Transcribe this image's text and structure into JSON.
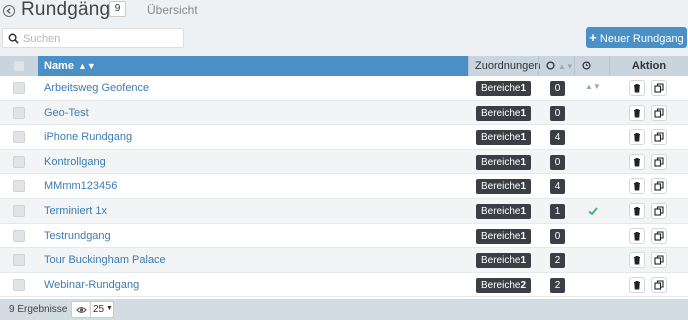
{
  "header": {
    "title": "Rundgänge",
    "count": "9",
    "subtitle": "Übersicht"
  },
  "toolbar": {
    "search_placeholder": "Suchen",
    "new_button_label": "Neuer Rundgang"
  },
  "table": {
    "columns": {
      "name": "Name",
      "zuordnungen": "Zuordnungen",
      "aktion": "Aktion"
    },
    "rows": [
      {
        "name": "Arbeitsweg Geofence",
        "bereiche_label": "Bereiche",
        "bereiche_count": "1",
        "count": "0",
        "checked": false
      },
      {
        "name": "Geo-Test",
        "bereiche_label": "Bereiche",
        "bereiche_count": "1",
        "count": "0",
        "checked": false
      },
      {
        "name": "iPhone Rundgang",
        "bereiche_label": "Bereiche",
        "bereiche_count": "1",
        "count": "4",
        "checked": false
      },
      {
        "name": "Kontrollgang",
        "bereiche_label": "Bereiche",
        "bereiche_count": "1",
        "count": "0",
        "checked": false
      },
      {
        "name": "MMmm123456",
        "bereiche_label": "Bereiche",
        "bereiche_count": "1",
        "count": "4",
        "checked": false
      },
      {
        "name": "Terminiert 1x",
        "bereiche_label": "Bereiche",
        "bereiche_count": "1",
        "count": "1",
        "checked": true
      },
      {
        "name": "Testrundgang",
        "bereiche_label": "Bereiche",
        "bereiche_count": "1",
        "count": "0",
        "checked": false
      },
      {
        "name": "Tour Buckingham Palace",
        "bereiche_label": "Bereiche",
        "bereiche_count": "1",
        "count": "2",
        "checked": false
      },
      {
        "name": "Webinar-Rundgang",
        "bereiche_label": "Bereiche",
        "bereiche_count": "2",
        "count": "2",
        "checked": false
      }
    ]
  },
  "footer": {
    "results": "9 Ergebnisse",
    "page_size": "25"
  },
  "colors": {
    "accent": "#4a90c7",
    "link": "#3d7cb5",
    "pill_dark": "#3b3f45",
    "success": "#3cb371"
  },
  "icons": [
    "back-circle-icon",
    "search-icon",
    "plus-icon",
    "sort-icon",
    "clock-icon",
    "trash-icon",
    "copy-icon",
    "check-icon",
    "eye-icon",
    "caret-down-icon"
  ]
}
